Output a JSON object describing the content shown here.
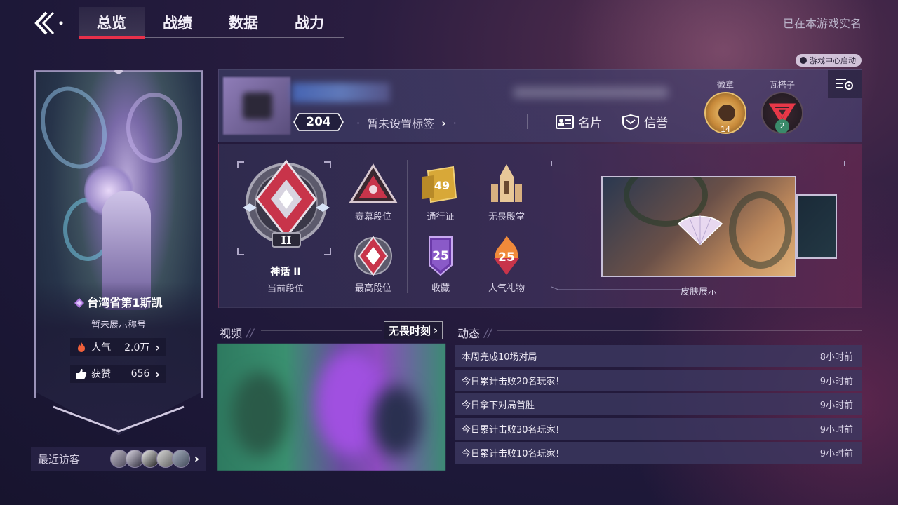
{
  "nav": {
    "tabs": [
      {
        "label": "总览",
        "active": true
      },
      {
        "label": "战绩",
        "active": false
      },
      {
        "label": "数据",
        "active": false
      },
      {
        "label": "战力",
        "active": false
      }
    ],
    "realname_text": "已在本游戏实名",
    "launch_badge": "游戏中心启动"
  },
  "banner": {
    "player_name": "台湾省第1斯凯",
    "title": "暂未展示称号",
    "popularity_label": "人气",
    "popularity_value": "2.0万",
    "likes_label": "获赞",
    "likes_value": "656"
  },
  "visitors": {
    "label": "最近访客",
    "count_shown": 5
  },
  "profile": {
    "level": "204",
    "tag_text": "暂未设置标签",
    "card_label": "名片",
    "credit_label": "信誉",
    "badge_label": "徽章",
    "badge_count": "14",
    "wazi_label": "瓦搭子",
    "wazi_count": "2"
  },
  "ranks": {
    "current_rank_name": "神话 II",
    "current_rank_caption": "当前段位",
    "current_rank_numeral": "II",
    "items": [
      {
        "id": "season",
        "label": "赛幕段位"
      },
      {
        "id": "pass",
        "label": "通行证",
        "value": "49"
      },
      {
        "id": "hall",
        "label": "无畏殿堂"
      },
      {
        "id": "highest",
        "label": "最高段位"
      },
      {
        "id": "collection",
        "label": "收藏",
        "value": "25"
      },
      {
        "id": "gifts",
        "label": "人气礼物",
        "value": "25"
      }
    ],
    "skin_label": "皮肤展示"
  },
  "video": {
    "section_title": "视频",
    "tag": "无畏时刻"
  },
  "feed": {
    "section_title": "动态",
    "items": [
      {
        "text": "本周完成10场对局",
        "time": "8小时前"
      },
      {
        "text": "今日累计击败20名玩家！",
        "time": "9小时前"
      },
      {
        "text": "今日拿下对局首胜",
        "time": "9小时前"
      },
      {
        "text": "今日累计击败30名玩家！",
        "time": "9小时前"
      },
      {
        "text": "今日累计击败10名玩家！",
        "time": "9小时前"
      }
    ]
  },
  "colors": {
    "accent_red": "#e8304a",
    "background": "#1d1838",
    "panel": "#3c3860"
  }
}
